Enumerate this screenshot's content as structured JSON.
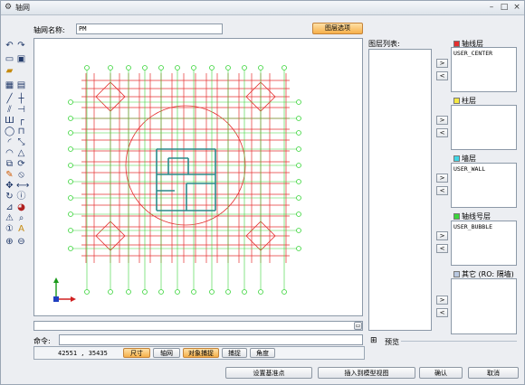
{
  "window": {
    "icon": "gear-icon",
    "title": "轴网",
    "controls": {
      "minimize": "–",
      "restore": "□",
      "close": "×"
    }
  },
  "header": {
    "name_label": "轴网名称:",
    "name_value": "PM",
    "layer_options_button": "图层选项"
  },
  "layer_panel": {
    "list_title": "图层列表:",
    "layers": [
      {
        "name": "轴线层",
        "color": "#e53030",
        "items": [
          "USER_CENTER"
        ]
      },
      {
        "name": "柱层",
        "color": "#f5e842",
        "items": []
      },
      {
        "name": "墙层",
        "color": "#40d6e6",
        "items": [
          "USER_WALL"
        ]
      },
      {
        "name": "轴线号层",
        "color": "#3ad53a",
        "items": [
          "USER_BUBBLE"
        ]
      },
      {
        "name": "其它 (RO: 隔墙)",
        "color": "#b9c8e0",
        "items": []
      }
    ],
    "add_label": ">",
    "remove_label": "<",
    "preview_toggle": "⊞",
    "preview_label": "预览"
  },
  "command": {
    "label": "命令:",
    "value": ""
  },
  "status": {
    "coords": "42551 , 35435",
    "modes": [
      {
        "label": "尺寸",
        "active": true
      },
      {
        "label": "轴网",
        "active": false
      },
      {
        "label": "对象捕捉",
        "active": true
      },
      {
        "label": "捕捉",
        "active": false
      },
      {
        "label": "角度",
        "active": false
      }
    ]
  },
  "footer": {
    "base_point_button": "设置基准点",
    "insert_button": "插入到模型视图",
    "ok_button": "确认",
    "cancel_button": "取消"
  },
  "colors": {
    "axis": "#e53030",
    "bubble": "#3ad53a",
    "wall": "#2a8a8a",
    "accent": "#f6b04a"
  }
}
